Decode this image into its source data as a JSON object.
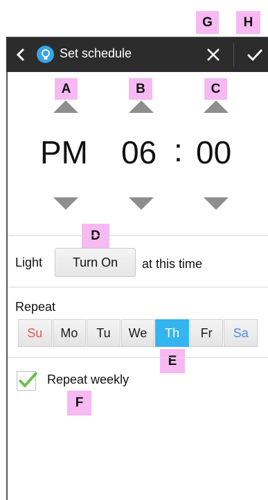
{
  "badges": {
    "a": "A",
    "b": "B",
    "c": "C",
    "d": "D",
    "e": "E",
    "f": "F",
    "g": "G",
    "h": "H"
  },
  "action_bar": {
    "title": "Set schedule",
    "background": "#2c2c2c",
    "app_icon": "lightbulb-icon",
    "back_icon": "chevron-left-icon",
    "close_icon": "close-icon",
    "confirm_icon": "check-icon"
  },
  "time_picker": {
    "ampm": "PM",
    "hour": "06",
    "separator": ":",
    "minute": "00",
    "arrow_color": "#8e8e8e"
  },
  "light_row": {
    "label": "Light",
    "button_label": "Turn On",
    "suffix": "at this time"
  },
  "repeat": {
    "label": "Repeat",
    "days": [
      {
        "label": "Su",
        "color": "#e0584c",
        "selected": false
      },
      {
        "label": "Mo",
        "color": "#1a1a1a",
        "selected": false
      },
      {
        "label": "Tu",
        "color": "#1a1a1a",
        "selected": false
      },
      {
        "label": "We",
        "color": "#1a1a1a",
        "selected": false
      },
      {
        "label": "Th",
        "color": "#ffffff",
        "selected": true
      },
      {
        "label": "Fr",
        "color": "#1a1a1a",
        "selected": false
      },
      {
        "label": "Sa",
        "color": "#4d8ed8",
        "selected": false
      }
    ],
    "selected_color": "#34b5f0",
    "weekly_checkbox_label": "Repeat weekly",
    "weekly_checked": true,
    "check_color": "#6cc04a"
  }
}
